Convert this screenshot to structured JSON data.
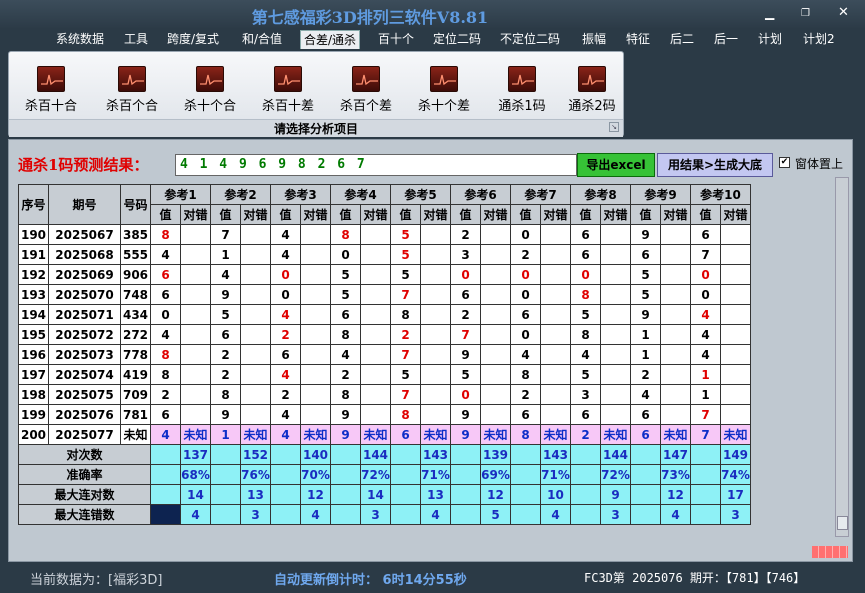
{
  "window": {
    "title": "第七感福彩3D排列三软件V8.81"
  },
  "menu": [
    "系统数据",
    "工具",
    "跨度/复式",
    "和/合值",
    "合差/通杀",
    "百十个",
    "定位二码",
    "不定位二码",
    "振幅",
    "特征",
    "后二",
    "后一",
    "计划",
    "计划2"
  ],
  "menu_active": "合差/通杀",
  "ribbon": {
    "tools": [
      "杀百十合",
      "杀百个合",
      "杀十个合",
      "杀百十差",
      "杀百个差",
      "杀十个差",
      "通杀1码",
      "通杀2码"
    ],
    "caption": "请选择分析项目"
  },
  "prediction": {
    "label": "通杀1码预测结果：",
    "value": "4 1 4 9 6 9 8 2 6 7",
    "export_btn": "导出excel",
    "generate_btn": "用结果>生成大底",
    "ontop_label": "窗体置上",
    "ontop_checked": true
  },
  "table": {
    "headers": {
      "seq": "序号",
      "issue": "期号",
      "number": "号码",
      "value": "值",
      "hit": "对错"
    },
    "refs": [
      "参考1",
      "参考2",
      "参考3",
      "参考4",
      "参考5",
      "参考6",
      "参考7",
      "参考8",
      "参考9",
      "参考10"
    ],
    "rows": [
      {
        "seq": "190",
        "issue": "2025067",
        "num": "385",
        "cells": [
          [
            "8",
            0
          ],
          [
            "7",
            1
          ],
          [
            "4",
            1
          ],
          [
            "8",
            0
          ],
          [
            "5",
            0
          ],
          [
            "2",
            1
          ],
          [
            "0",
            1
          ],
          [
            "6",
            1
          ],
          [
            "9",
            1
          ],
          [
            "6",
            1
          ]
        ]
      },
      {
        "seq": "191",
        "issue": "2025068",
        "num": "555",
        "cells": [
          [
            "4",
            1
          ],
          [
            "1",
            1
          ],
          [
            "4",
            1
          ],
          [
            "0",
            1
          ],
          [
            "5",
            0
          ],
          [
            "3",
            1
          ],
          [
            "2",
            1
          ],
          [
            "6",
            1
          ],
          [
            "6",
            1
          ],
          [
            "7",
            1
          ]
        ]
      },
      {
        "seq": "192",
        "issue": "2025069",
        "num": "906",
        "cells": [
          [
            "6",
            0
          ],
          [
            "4",
            1
          ],
          [
            "0",
            0
          ],
          [
            "5",
            1
          ],
          [
            "5",
            1
          ],
          [
            "0",
            0
          ],
          [
            "0",
            0
          ],
          [
            "0",
            0
          ],
          [
            "5",
            1
          ],
          [
            "0",
            0
          ]
        ]
      },
      {
        "seq": "193",
        "issue": "2025070",
        "num": "748",
        "cells": [
          [
            "6",
            1
          ],
          [
            "9",
            1
          ],
          [
            "0",
            1
          ],
          [
            "5",
            1
          ],
          [
            "7",
            0
          ],
          [
            "6",
            1
          ],
          [
            "0",
            1
          ],
          [
            "8",
            0
          ],
          [
            "5",
            1
          ],
          [
            "0",
            1
          ]
        ]
      },
      {
        "seq": "194",
        "issue": "2025071",
        "num": "434",
        "cells": [
          [
            "0",
            1
          ],
          [
            "5",
            1
          ],
          [
            "4",
            0
          ],
          [
            "6",
            1
          ],
          [
            "8",
            1
          ],
          [
            "2",
            1
          ],
          [
            "6",
            1
          ],
          [
            "5",
            1
          ],
          [
            "9",
            1
          ],
          [
            "4",
            0
          ]
        ]
      },
      {
        "seq": "195",
        "issue": "2025072",
        "num": "272",
        "cells": [
          [
            "4",
            1
          ],
          [
            "6",
            1
          ],
          [
            "2",
            0
          ],
          [
            "8",
            1
          ],
          [
            "2",
            0
          ],
          [
            "7",
            0
          ],
          [
            "0",
            1
          ],
          [
            "8",
            1
          ],
          [
            "1",
            1
          ],
          [
            "4",
            1
          ]
        ]
      },
      {
        "seq": "196",
        "issue": "2025073",
        "num": "778",
        "cells": [
          [
            "8",
            0
          ],
          [
            "2",
            1
          ],
          [
            "6",
            1
          ],
          [
            "4",
            1
          ],
          [
            "7",
            0
          ],
          [
            "9",
            1
          ],
          [
            "4",
            1
          ],
          [
            "4",
            1
          ],
          [
            "1",
            1
          ],
          [
            "4",
            1
          ]
        ]
      },
      {
        "seq": "197",
        "issue": "2025074",
        "num": "419",
        "cells": [
          [
            "8",
            1
          ],
          [
            "2",
            1
          ],
          [
            "4",
            0
          ],
          [
            "2",
            1
          ],
          [
            "5",
            1
          ],
          [
            "5",
            1
          ],
          [
            "8",
            1
          ],
          [
            "5",
            1
          ],
          [
            "2",
            1
          ],
          [
            "1",
            0
          ]
        ]
      },
      {
        "seq": "198",
        "issue": "2025075",
        "num": "709",
        "cells": [
          [
            "2",
            1
          ],
          [
            "8",
            1
          ],
          [
            "2",
            1
          ],
          [
            "8",
            1
          ],
          [
            "7",
            0
          ],
          [
            "0",
            0
          ],
          [
            "2",
            1
          ],
          [
            "3",
            1
          ],
          [
            "4",
            1
          ],
          [
            "1",
            1
          ]
        ]
      },
      {
        "seq": "199",
        "issue": "2025076",
        "num": "781",
        "cells": [
          [
            "6",
            1
          ],
          [
            "9",
            1
          ],
          [
            "4",
            1
          ],
          [
            "9",
            1
          ],
          [
            "8",
            0
          ],
          [
            "9",
            1
          ],
          [
            "6",
            1
          ],
          [
            "6",
            1
          ],
          [
            "6",
            1
          ],
          [
            "7",
            0
          ]
        ]
      }
    ],
    "unknown_row": {
      "seq": "200",
      "issue": "2025077",
      "num": "未知",
      "cells": [
        [
          "4",
          "未知"
        ],
        [
          "1",
          "未知"
        ],
        [
          "4",
          "未知"
        ],
        [
          "9",
          "未知"
        ],
        [
          "6",
          "未知"
        ],
        [
          "9",
          "未知"
        ],
        [
          "8",
          "未知"
        ],
        [
          "2",
          "未知"
        ],
        [
          "6",
          "未知"
        ],
        [
          "7",
          "未知"
        ]
      ]
    },
    "summary": [
      {
        "label": "对次数",
        "values": [
          "137",
          "152",
          "140",
          "144",
          "143",
          "139",
          "143",
          "144",
          "147",
          "149"
        ]
      },
      {
        "label": "准确率",
        "values": [
          "68%",
          "76%",
          "70%",
          "72%",
          "71%",
          "69%",
          "71%",
          "72%",
          "73%",
          "74%"
        ]
      },
      {
        "label": "最大连对数",
        "values": [
          "14",
          "13",
          "12",
          "14",
          "13",
          "12",
          "10",
          "9",
          "12",
          "17"
        ]
      },
      {
        "label": "最大连错数",
        "values": [
          "4",
          "3",
          "4",
          "3",
          "4",
          "5",
          "4",
          "3",
          "4",
          "3"
        ]
      }
    ],
    "hit_mark": "对"
  },
  "status": {
    "source": "当前数据为：[福彩3D]",
    "countdown": "自动更新倒计时： 6时14分55秒",
    "issue": "FC3D第 2025076 期开：【781】【746】"
  }
}
